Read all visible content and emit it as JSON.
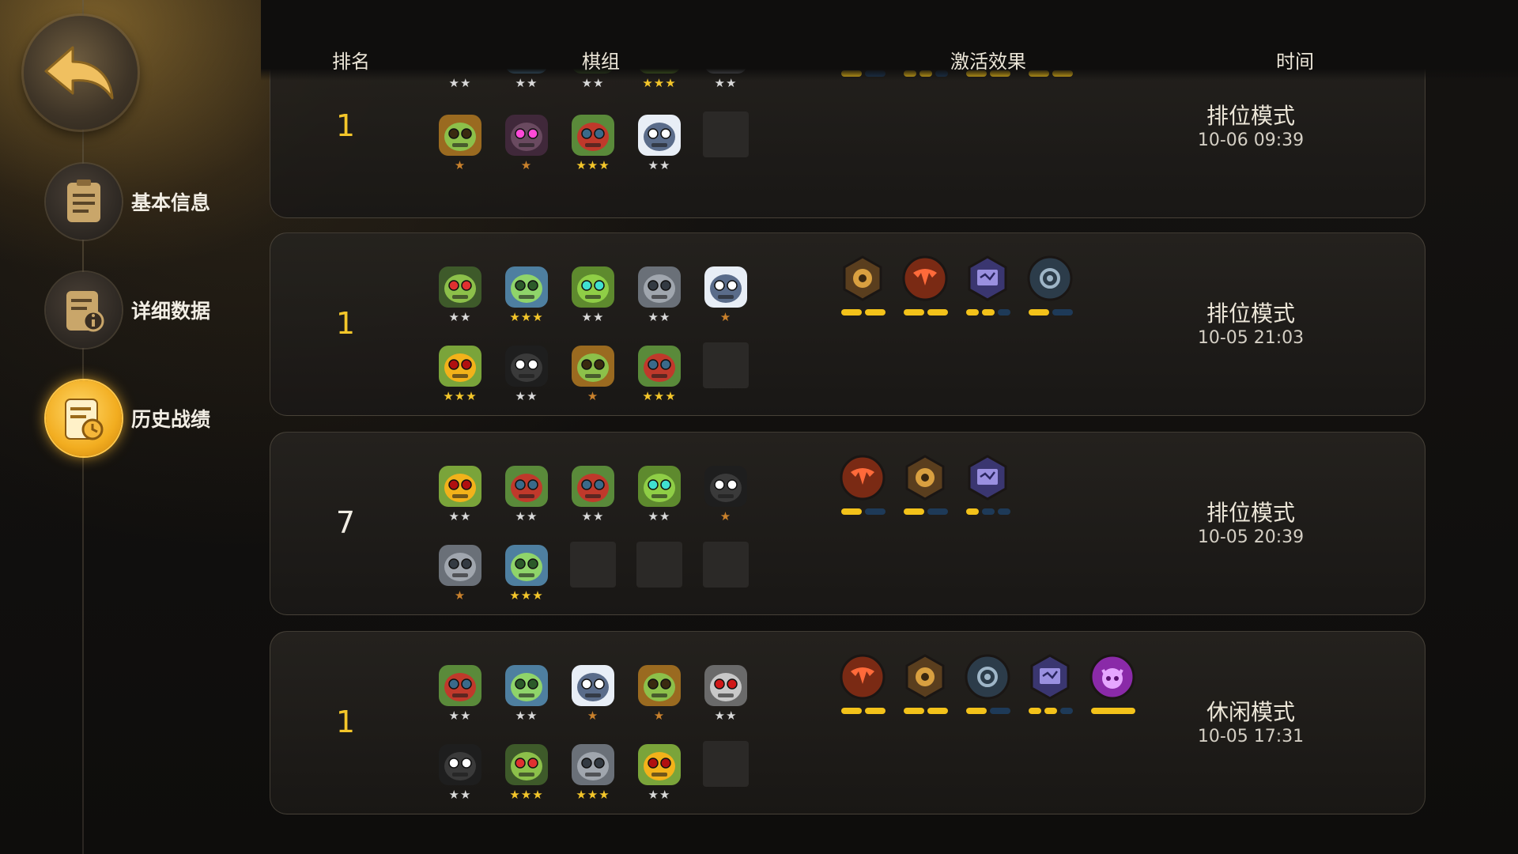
{
  "header": {
    "rank": "排名",
    "team": "棋组",
    "synergy": "激活效果",
    "time": "时间"
  },
  "sidebar": {
    "items": [
      {
        "label": "基本信息",
        "icon": "notepad-icon",
        "active": false
      },
      {
        "label": "详细数据",
        "icon": "data-info-icon",
        "active": false
      },
      {
        "label": "历史战绩",
        "icon": "history-clock-icon",
        "active": true
      }
    ]
  },
  "matches": [
    {
      "rank": "1",
      "rank_color": "#f4c62a",
      "mode": "排位模式",
      "date": "10-06 09:39",
      "units_top": [
        {
          "type": "dark-hood",
          "stars": "★★",
          "star_color": "#d9d9d9"
        },
        {
          "type": "blue-golem",
          "stars": "★★",
          "star_color": "#d9d9d9"
        },
        {
          "type": "mech-goblin",
          "stars": "★★",
          "star_color": "#d9d9d9"
        },
        {
          "type": "horned-green",
          "stars": "★★★",
          "star_color": "#f4c62a"
        },
        {
          "type": "stone-crown",
          "stars": "★★",
          "star_color": "#d9d9d9"
        }
      ],
      "units_bottom": [
        {
          "type": "fire-troll",
          "stars": "★",
          "star_color": "#c9812c"
        },
        {
          "type": "pink-demon",
          "stars": "★",
          "star_color": "#c9812c"
        },
        {
          "type": "green-ogre",
          "stars": "★★★",
          "star_color": "#f4c62a"
        },
        {
          "type": "white-hair",
          "stars": "★★",
          "star_color": "#d9d9d9"
        },
        {
          "type": "empty",
          "stars": "",
          "star_color": "#d9d9d9"
        }
      ],
      "synergies": [
        {
          "icon": "goblin-emblem-icon",
          "color": "#2c3c4a",
          "bars": [
            1,
            0
          ]
        },
        {
          "icon": "spellbook-emblem-icon",
          "color": "#3a3670",
          "bars": [
            1,
            1,
            0
          ]
        },
        {
          "icon": "gear-emblem-icon",
          "color": "#5a3e1e",
          "bars": [
            1,
            1
          ]
        },
        {
          "icon": "horn-emblem-icon",
          "color": "#7a2a14",
          "bars": [
            1,
            1
          ]
        }
      ]
    },
    {
      "rank": "1",
      "rank_color": "#f4c62a",
      "mode": "排位模式",
      "date": "10-05 21:03",
      "units_top": [
        {
          "type": "mech-goblin",
          "stars": "★★",
          "star_color": "#d9d9d9"
        },
        {
          "type": "blue-golem",
          "stars": "★★★",
          "star_color": "#f4c62a"
        },
        {
          "type": "horned-green",
          "stars": "★★",
          "star_color": "#d9d9d9"
        },
        {
          "type": "stone-crown",
          "stars": "★★",
          "star_color": "#d9d9d9"
        },
        {
          "type": "white-hair",
          "stars": "★",
          "star_color": "#c9812c"
        }
      ],
      "units_bottom": [
        {
          "type": "goggle-goblin",
          "stars": "★★★",
          "star_color": "#f4c62a"
        },
        {
          "type": "dark-hood",
          "stars": "★★",
          "star_color": "#d9d9d9"
        },
        {
          "type": "fire-troll",
          "stars": "★",
          "star_color": "#c9812c"
        },
        {
          "type": "green-ogre",
          "stars": "★★★",
          "star_color": "#f4c62a"
        },
        {
          "type": "empty",
          "stars": "",
          "star_color": "#d9d9d9"
        }
      ],
      "synergies": [
        {
          "icon": "gear-emblem-icon",
          "color": "#5a3e1e",
          "bars": [
            1,
            1
          ]
        },
        {
          "icon": "horn-emblem-icon",
          "color": "#7a2a14",
          "bars": [
            1,
            1
          ]
        },
        {
          "icon": "spellbook-emblem-icon",
          "color": "#3a3670",
          "bars": [
            1,
            1,
            0
          ]
        },
        {
          "icon": "goblin-emblem-icon",
          "color": "#2c3c4a",
          "bars": [
            1,
            0
          ]
        }
      ]
    },
    {
      "rank": "7",
      "rank_color": "#f1ede4",
      "mode": "排位模式",
      "date": "10-05 20:39",
      "units_top": [
        {
          "type": "goggle-goblin",
          "stars": "★★",
          "star_color": "#d9d9d9"
        },
        {
          "type": "green-ogre",
          "stars": "★★",
          "star_color": "#d9d9d9"
        },
        {
          "type": "green-ogre",
          "stars": "★★",
          "star_color": "#d9d9d9"
        },
        {
          "type": "horned-green",
          "stars": "★★",
          "star_color": "#d9d9d9"
        },
        {
          "type": "dark-hood",
          "stars": "★",
          "star_color": "#c9812c"
        }
      ],
      "units_bottom": [
        {
          "type": "stone-crown",
          "stars": "★",
          "star_color": "#c9812c"
        },
        {
          "type": "blue-golem",
          "stars": "★★★",
          "star_color": "#f4c62a"
        },
        {
          "type": "empty",
          "stars": "",
          "star_color": "#d9d9d9"
        },
        {
          "type": "empty",
          "stars": "",
          "star_color": "#d9d9d9"
        },
        {
          "type": "empty",
          "stars": "",
          "star_color": "#d9d9d9"
        }
      ],
      "synergies": [
        {
          "icon": "horn-emblem-icon",
          "color": "#7a2a14",
          "bars": [
            1,
            0
          ]
        },
        {
          "icon": "gear-emblem-icon",
          "color": "#5a3e1e",
          "bars": [
            1,
            0
          ]
        },
        {
          "icon": "spellbook-emblem-icon",
          "color": "#3a3670",
          "bars": [
            1,
            0,
            0
          ]
        }
      ]
    },
    {
      "rank": "1",
      "rank_color": "#f4c62a",
      "mode": "休闲模式",
      "date": "10-05 17:31",
      "units_top": [
        {
          "type": "green-ogre",
          "stars": "★★",
          "star_color": "#d9d9d9"
        },
        {
          "type": "blue-golem",
          "stars": "★★",
          "star_color": "#d9d9d9"
        },
        {
          "type": "white-hair",
          "stars": "★",
          "star_color": "#c9812c"
        },
        {
          "type": "fire-troll",
          "stars": "★",
          "star_color": "#c9812c"
        },
        {
          "type": "skull-knight",
          "stars": "★★",
          "star_color": "#d9d9d9"
        }
      ],
      "units_bottom": [
        {
          "type": "dark-hood",
          "stars": "★★",
          "star_color": "#d9d9d9"
        },
        {
          "type": "mech-goblin",
          "stars": "★★★",
          "star_color": "#f4c62a"
        },
        {
          "type": "stone-crown",
          "stars": "★★★",
          "star_color": "#f4c62a"
        },
        {
          "type": "goggle-goblin",
          "stars": "★★",
          "star_color": "#d9d9d9"
        },
        {
          "type": "empty",
          "stars": "",
          "star_color": "#d9d9d9"
        }
      ],
      "synergies": [
        {
          "icon": "horn-emblem-icon",
          "color": "#7a2a14",
          "bars": [
            1,
            1
          ]
        },
        {
          "icon": "gear-emblem-icon",
          "color": "#5a3e1e",
          "bars": [
            1,
            1
          ]
        },
        {
          "icon": "goblin-emblem-icon",
          "color": "#2c3c4a",
          "bars": [
            1,
            0
          ]
        },
        {
          "icon": "spellbook-emblem-icon",
          "color": "#3a3670",
          "bars": [
            1,
            1,
            0
          ]
        },
        {
          "icon": "demon-emblem-icon",
          "color": "#8a2aa8",
          "bars": [
            1
          ]
        }
      ]
    }
  ]
}
